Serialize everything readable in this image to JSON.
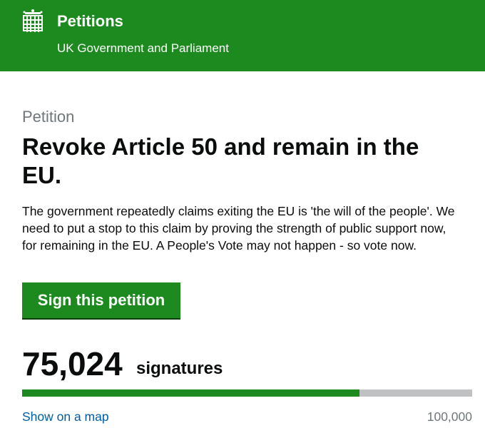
{
  "header": {
    "title": "Petitions",
    "subtitle": "UK Government and Parliament",
    "logo_icon": "portcullis-icon",
    "background_color": "#1c8a1e"
  },
  "petition": {
    "eyebrow": "Petition",
    "title": "Revoke Article 50 and remain in the EU.",
    "description": "The government repeatedly claims exiting the EU is 'the will of the people'. We need to put a stop to this claim by proving the strength of public support now, for remaining in the EU. A People's Vote may not happen - so vote now.",
    "sign_button_label": "Sign this petition"
  },
  "signatures": {
    "count": "75,024",
    "label": "signatures",
    "progress_fraction": 0.75024,
    "target": "100,000",
    "map_link_label": "Show on a map"
  }
}
